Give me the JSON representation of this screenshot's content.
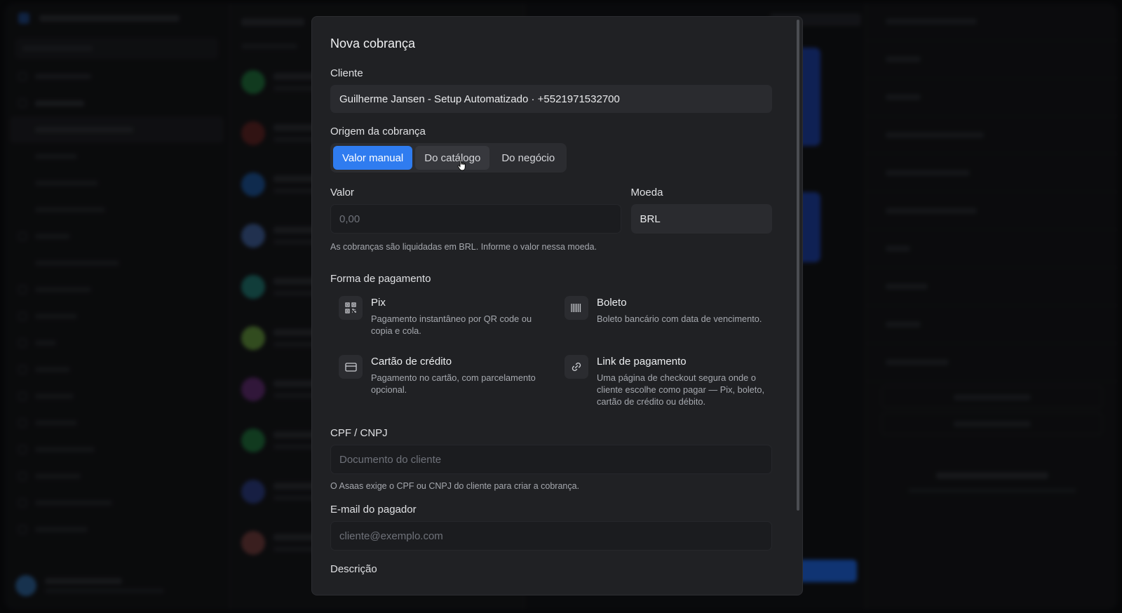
{
  "modal": {
    "title": "Nova cobrança",
    "cliente": {
      "label": "Cliente",
      "value": "Guilherme Jansen - Setup Automatizado · +5521971532700"
    },
    "origem": {
      "label": "Origem da cobrança",
      "options": [
        "Valor manual",
        "Do catálogo",
        "Do negócio"
      ],
      "selected": "Valor manual"
    },
    "valor": {
      "label": "Valor",
      "placeholder": "0,00"
    },
    "moeda": {
      "label": "Moeda",
      "value": "BRL"
    },
    "valor_hint": "As cobranças são liquidadas em BRL. Informe o valor nessa moeda.",
    "forma_pagamento": {
      "label": "Forma de pagamento",
      "methods": [
        {
          "icon": "qr-code-icon",
          "title": "Pix",
          "desc": "Pagamento instantâneo por QR code ou copia e cola."
        },
        {
          "icon": "barcode-icon",
          "title": "Boleto",
          "desc": "Boleto bancário com data de vencimento."
        },
        {
          "icon": "credit-card-icon",
          "title": "Cartão de crédito",
          "desc": "Pagamento no cartão, com parcelamento opcional."
        },
        {
          "icon": "link-icon",
          "title": "Link de pagamento",
          "desc": "Uma página de checkout segura onde o cliente escolhe como pagar — Pix, boleto, cartão de crédito ou débito."
        }
      ]
    },
    "documento": {
      "label": "CPF / CNPJ",
      "placeholder": "Documento do cliente",
      "hint": "O Asaas exige o CPF ou CNPJ do cliente para criar a cobrança."
    },
    "email": {
      "label": "E-mail do pagador",
      "placeholder": "cliente@exemplo.com"
    },
    "descricao": {
      "label": "Descrição"
    }
  },
  "colors": {
    "accent": "#2f7cf0",
    "modal_bg": "#202124",
    "field_bg": "#2a2b2f"
  }
}
